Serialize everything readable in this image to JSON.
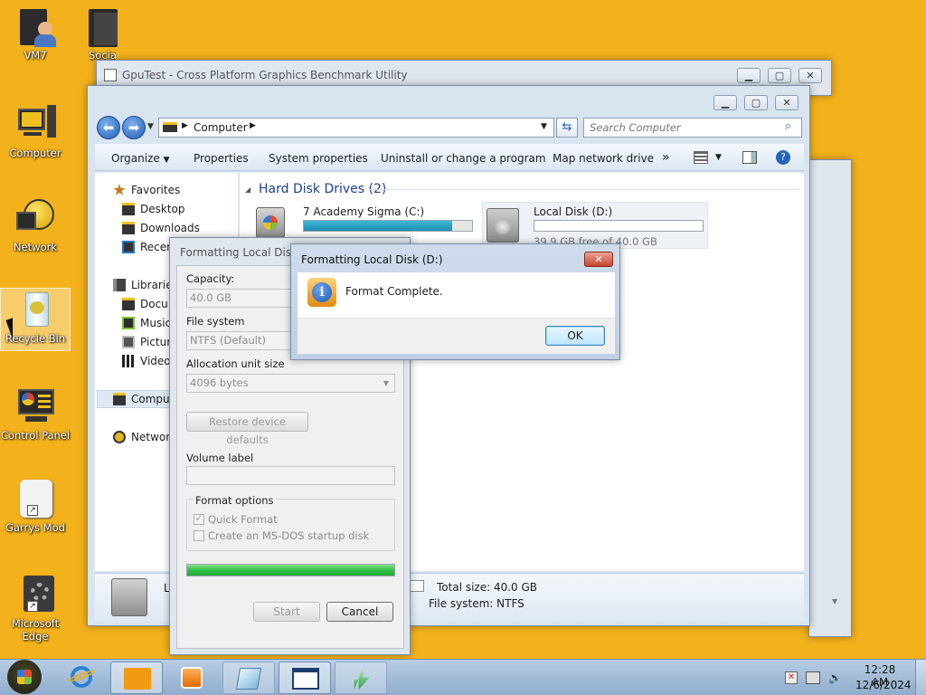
{
  "desktop": {
    "icons": [
      {
        "label": "VM7"
      },
      {
        "label": "Social Media"
      },
      {
        "label": "Computer"
      },
      {
        "label": "Network"
      },
      {
        "label": "Recycle Bin"
      },
      {
        "label": "Control Panel"
      },
      {
        "label": "Garrys Mod"
      },
      {
        "label": "Microsoft Edge"
      }
    ]
  },
  "gputest": {
    "title": "GpuTest - Cross Platform Graphics Benchmark Utility"
  },
  "explorer": {
    "breadcrumb": "Computer",
    "search_placeholder": "Search Computer",
    "toolbar": {
      "organize": "Organize",
      "properties": "Properties",
      "system_properties": "System properties",
      "uninstall": "Uninstall or change a program",
      "map_drive": "Map network drive",
      "more": "»"
    },
    "nav": {
      "favorites": "Favorites",
      "desktop": "Desktop",
      "downloads": "Downloads",
      "recent": "Recen",
      "libraries": "Libraries",
      "documents": "Docu",
      "music": "Music",
      "pictures": "Pictur",
      "videos": "Videos",
      "computer": "Comput",
      "network": "Network"
    },
    "section_title": "Hard Disk Drives (2)",
    "drives": [
      {
        "name": "7 Academy Sigma (C:)",
        "fill": 0.88
      },
      {
        "name": "Local Disk (D:)",
        "free": "39.9 GB free of 40.0 GB",
        "fill": 0.0
      }
    ],
    "details": {
      "name_partial": "L",
      "total_size": "Total size: 40.0 GB",
      "file_system": "File system: NTFS"
    }
  },
  "format_dialog": {
    "title": "Formatting Local Disk (",
    "capacity_label": "Capacity:",
    "capacity_value": "40.0 GB",
    "fs_label": "File system",
    "fs_value": "NTFS (Default)",
    "alloc_label": "Allocation unit size",
    "alloc_value": "4096 bytes",
    "restore_label": "Restore device defaults",
    "volume_label": "Volume label",
    "options_label": "Format options",
    "quick_format": "Quick Format",
    "msdos": "Create an MS-DOS startup disk",
    "progress": 1.0,
    "start": "Start",
    "cancel": "Cancel"
  },
  "msgbox": {
    "title": "Formatting Local Disk (D:)",
    "message": "Format Complete.",
    "ok": "OK"
  },
  "taskbar": {
    "time": "12:28 AM",
    "date": "12/6/2024"
  },
  "colors": {
    "desktop": "#f3b21c",
    "drive_bar": "#2aa0c0",
    "progress": "#33c24b"
  }
}
